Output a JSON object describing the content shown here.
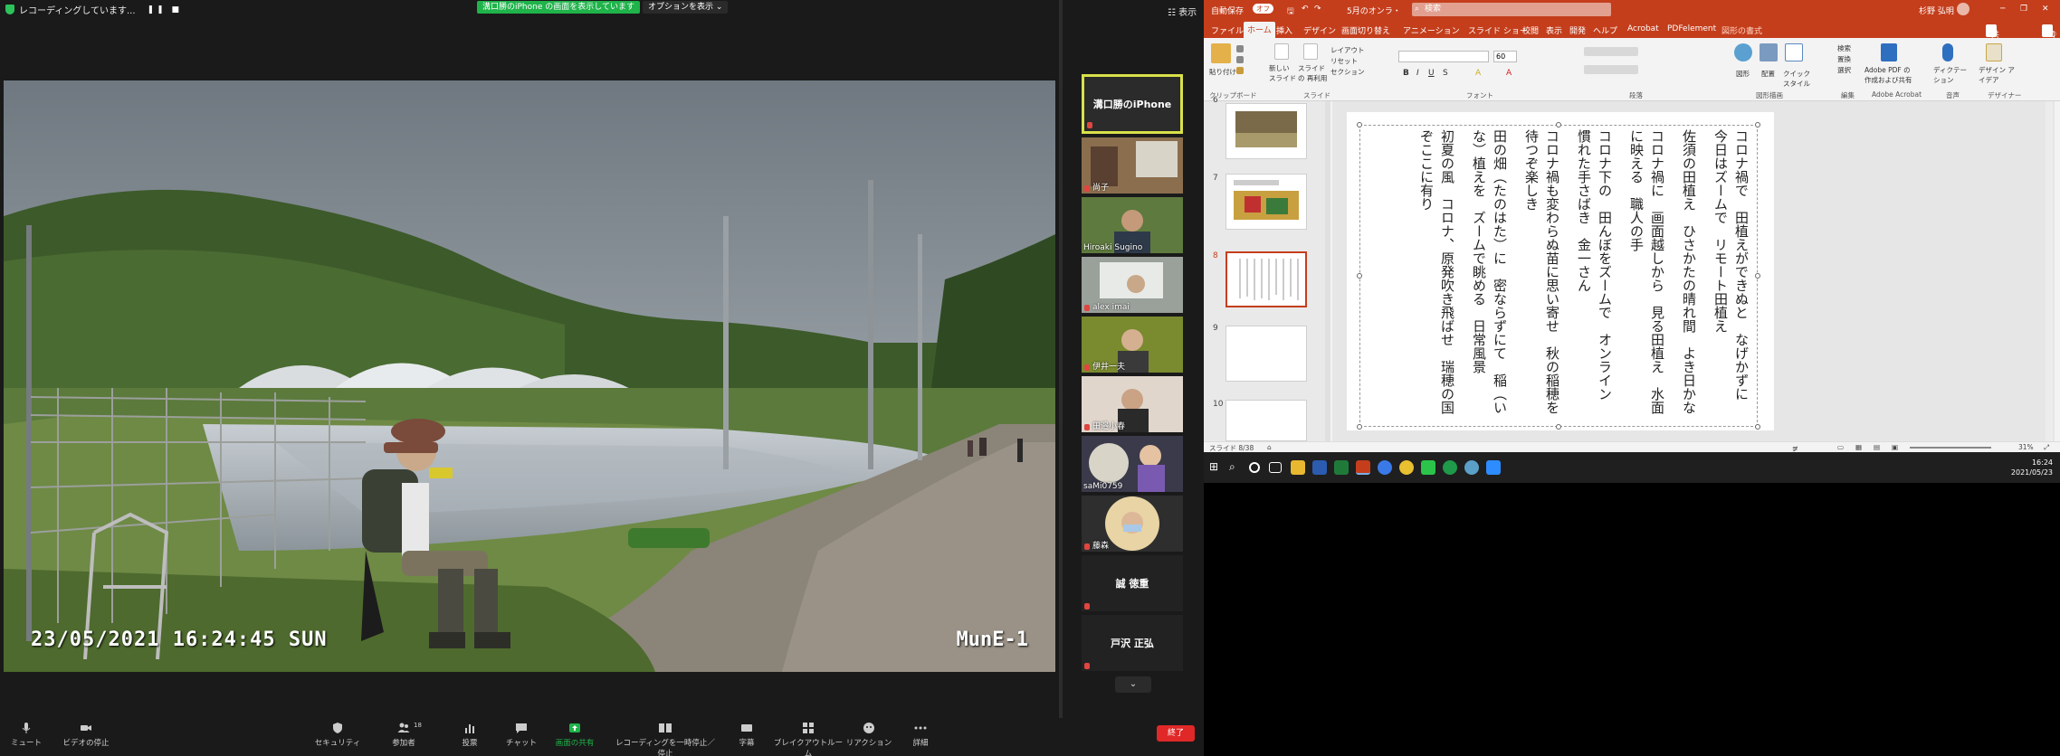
{
  "zoom": {
    "recording_status": "レコーディングしています...",
    "share_banner": "溝口勝のiPhone の画面を表示しています",
    "options_label": "オプションを表示",
    "view_label": "表示",
    "video": {
      "timestamp": "23/05/2021 16:24:45 SUN",
      "camera_name": "MunE-1"
    },
    "participants": [
      {
        "name": "溝口勝のiPhone",
        "type": "active"
      },
      {
        "name": "尚子",
        "type": "video",
        "bg": "#7a5a3a"
      },
      {
        "name": "Hiroaki Sugino",
        "type": "video",
        "bg": "#556b3a"
      },
      {
        "name": "alex imai",
        "type": "video",
        "bg": "#8a8e8a"
      },
      {
        "name": "伊井一夫",
        "type": "video",
        "bg": "#6a7a2a"
      },
      {
        "name": "田邉小春",
        "type": "video",
        "bg": "#c9b8a8"
      },
      {
        "name": "saMi0759",
        "type": "video",
        "bg": "#5a5a7a"
      },
      {
        "name": "藤森",
        "type": "video",
        "bg": "#c9a86a"
      },
      {
        "name": "誠 徳重",
        "type": "name"
      },
      {
        "name": "戸沢 正弘",
        "type": "name"
      }
    ],
    "toolbar": {
      "mute": "ミュート",
      "stop_video": "ビデオの停止",
      "security": "セキュリティ",
      "participants": "参加者",
      "participant_count": "18",
      "polls": "投票",
      "chat": "チャット",
      "share_screen": "画面の共有",
      "pause_recording": "レコーディングを一時停止／停止",
      "captions": "字幕",
      "breakout": "ブレイクアウトルーム",
      "reactions": "リアクション",
      "more": "詳細",
      "end": "終了"
    }
  },
  "ppt": {
    "autosave": "自動保存",
    "autosave_state": "オフ",
    "filename": "5月のオンラ・",
    "search_placeholder": "検索",
    "user": "杉野 弘明",
    "tabs": [
      "ファイル",
      "ホーム",
      "挿入",
      "デザイン",
      "画面切り替え",
      "アニメーション",
      "スライド ショー",
      "校閲",
      "表示",
      "開発",
      "ヘルプ",
      "Acrobat",
      "PDFelement",
      "図形の書式"
    ],
    "selected_tab": "ホーム",
    "share_label": "共有",
    "comment_label": "コメント",
    "ribbon": {
      "paste": "貼り付け",
      "new_slide": "新しい スライド",
      "reuse_slide": "スライドの 再利用",
      "layout": "レイアウト",
      "reset": "リセット",
      "section": "セクション",
      "font_size": "60",
      "shapes": "図形",
      "arrange": "配置",
      "quick_styles": "クイック スタイル",
      "find": "検索",
      "replace": "置換",
      "select": "選択",
      "acrobat_pdf": "Adobe PDF の 作成および共有",
      "dictate": "ディクテー ション",
      "design_ideas": "デザイン アイデア",
      "groups": [
        "クリップボード",
        "スライド",
        "フォント",
        "段落",
        "図形描画",
        "編集",
        "Adobe Acrobat",
        "音声",
        "デザイナー"
      ]
    },
    "thumbnails": [
      {
        "num": "6"
      },
      {
        "num": "7"
      },
      {
        "num": "8",
        "selected": true
      },
      {
        "num": "9"
      },
      {
        "num": "10"
      }
    ],
    "slide_lines": [
      "コロナ禍で　田植えができぬと　なげかずに　今日はズームで　リモート田植え",
      "佐須の田植え　ひさかたの晴れ間　よき日かな",
      "コロナ禍に　画面越しから　見る田植え　水面に映える　職人の手",
      "コロナ下の　田んぼをズームで　オンライン　慣れた手さばき　金一さん",
      "コロナ禍も変わらぬ苗に思い寄せ　秋の稲穂を待つぞ楽しき",
      "田の畑（たのはた）に　密ならずにて　稲（いな）植えを　ズームで眺める　日常風景",
      "初夏の風　コロナ、原発吹き飛ばせ　瑞穂の国ぞここに有り"
    ],
    "status": {
      "slide_info": "スライド 8/38",
      "notes": "ノート",
      "zoom": "31%"
    }
  },
  "taskbar": {
    "time": "16:24",
    "date": "2021/05/23"
  }
}
